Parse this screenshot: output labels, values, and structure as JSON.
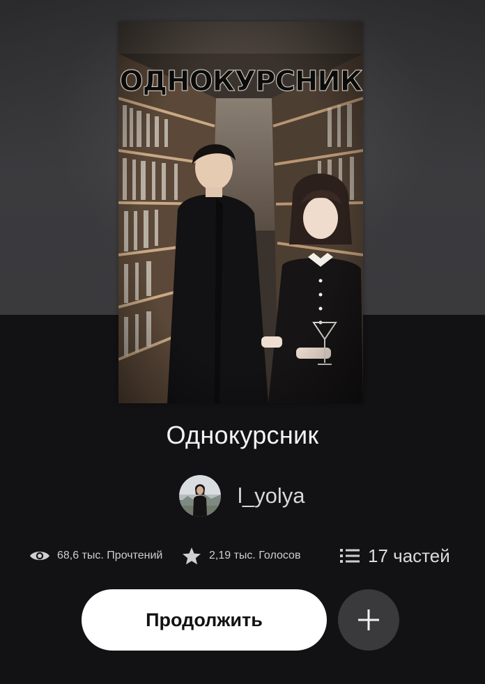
{
  "cover": {
    "title_text": "ОДНОКУРСНИК"
  },
  "book": {
    "title": "Однокурсник"
  },
  "author": {
    "name": "l_yolya"
  },
  "stats": {
    "reads_icon": "eye-icon",
    "reads": "68,6 тыс. Прочтений",
    "votes_icon": "star-icon",
    "votes": "2,19 тыс. Голосов",
    "parts_icon": "list-icon",
    "parts": "17 частей"
  },
  "actions": {
    "continue_label": "Продолжить",
    "add_icon": "plus-icon"
  },
  "colors": {
    "background": "#121113",
    "header_background": "#3a3a3d",
    "button_primary": "#ffffff",
    "button_secondary": "#3a393c",
    "text_primary": "#f4f4f4",
    "text_secondary": "#cfcfcf"
  }
}
